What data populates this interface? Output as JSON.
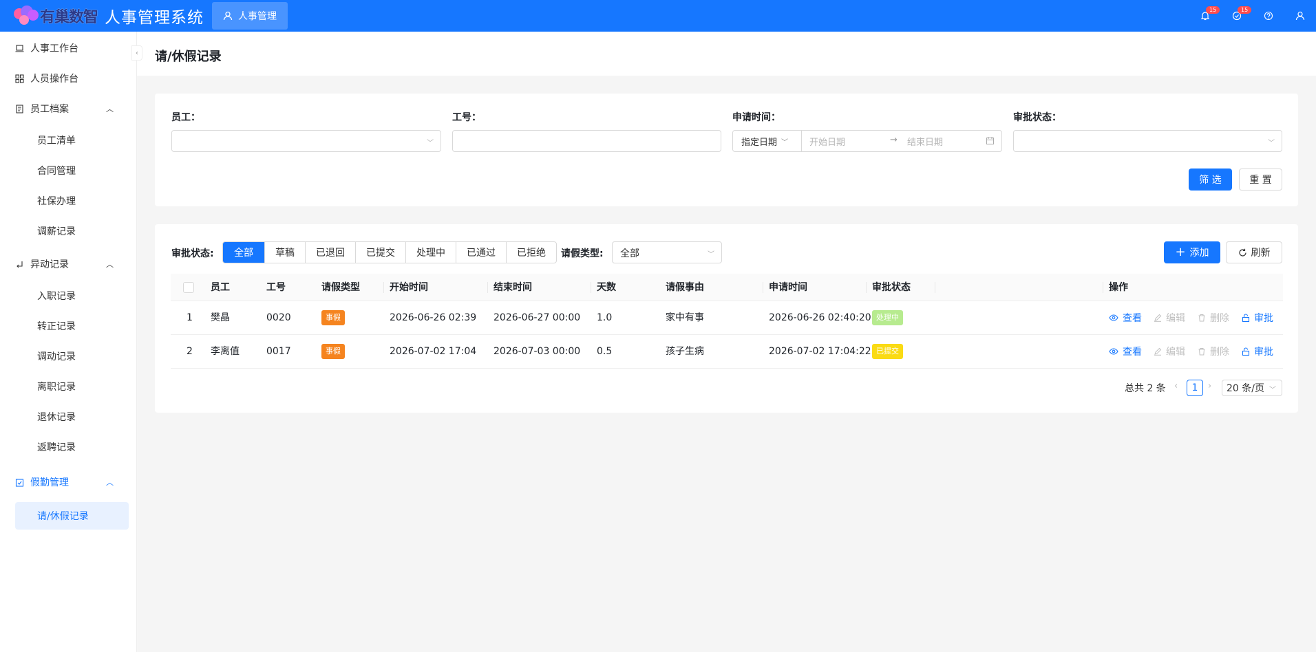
{
  "brand": {
    "logo_text": "有巢数智",
    "system_title": "人事管理系统",
    "active_module": "人事管理"
  },
  "topbar": {
    "notify_count": "15",
    "task_count": "15"
  },
  "sidebar": {
    "workbench": "人事工作台",
    "staff_ops": "人员操作台",
    "archive_group": "员工档案",
    "archive_items": [
      "员工清单",
      "合同管理",
      "社保办理",
      "调薪记录"
    ],
    "change_group": "异动记录",
    "change_items": [
      "入职记录",
      "转正记录",
      "调动记录",
      "离职记录",
      "退休记录",
      "返聘记录"
    ],
    "attendance_group": "假勤管理",
    "attendance_items": [
      "请/休假记录"
    ]
  },
  "page": {
    "title": "请/休假记录"
  },
  "filter": {
    "employee_label": "员工：",
    "emp_no_label": "工号：",
    "apply_time_label": "申请时间：",
    "status_label": "审批状态：",
    "date_mode": "指定日期",
    "start_placeholder": "开始日期",
    "end_placeholder": "结束日期",
    "filter_button": "筛 选",
    "reset_button": "重 置"
  },
  "toolbar": {
    "status_label": "审批状态:",
    "status_tabs": [
      "全部",
      "草稿",
      "已退回",
      "已提交",
      "处理中",
      "已通过",
      "已拒绝"
    ],
    "active_tab": "全部",
    "leave_type_label": "请假类型:",
    "leave_type_value": "全部",
    "add_button": "添加",
    "refresh_button": "刷新"
  },
  "table": {
    "columns": [
      "员工",
      "工号",
      "请假类型",
      "开始时间",
      "结束时间",
      "天数",
      "请假事由",
      "申请时间",
      "审批状态",
      "操作"
    ],
    "rows": [
      {
        "index": "1",
        "employee": "樊晶",
        "emp_no": "0020",
        "leave_type": "事假",
        "start": "2026-06-26 02:39",
        "end": "2026-06-27 00:00",
        "days": "1.0",
        "reason": "家中有事",
        "applied": "2026-06-26 02:40:20",
        "status": "处理中"
      },
      {
        "index": "2",
        "employee": "李离值",
        "emp_no": "0017",
        "leave_type": "事假",
        "start": "2026-07-02 17:04",
        "end": "2026-07-03 00:00",
        "days": "0.5",
        "reason": "孩子生病",
        "applied": "2026-07-02 17:04:22",
        "status": "已提交"
      }
    ],
    "actions": {
      "view": "查看",
      "edit": "编辑",
      "delete": "删除",
      "approve": "审批"
    }
  },
  "pagination": {
    "total_text": "总共 2 条",
    "current_page": "1",
    "page_size": "20 条/页"
  },
  "colors": {
    "primary": "#1677ff",
    "leave_tag": "#f5841f",
    "status_processing": "#b7eb8f",
    "status_submitted": "#fadb14"
  }
}
